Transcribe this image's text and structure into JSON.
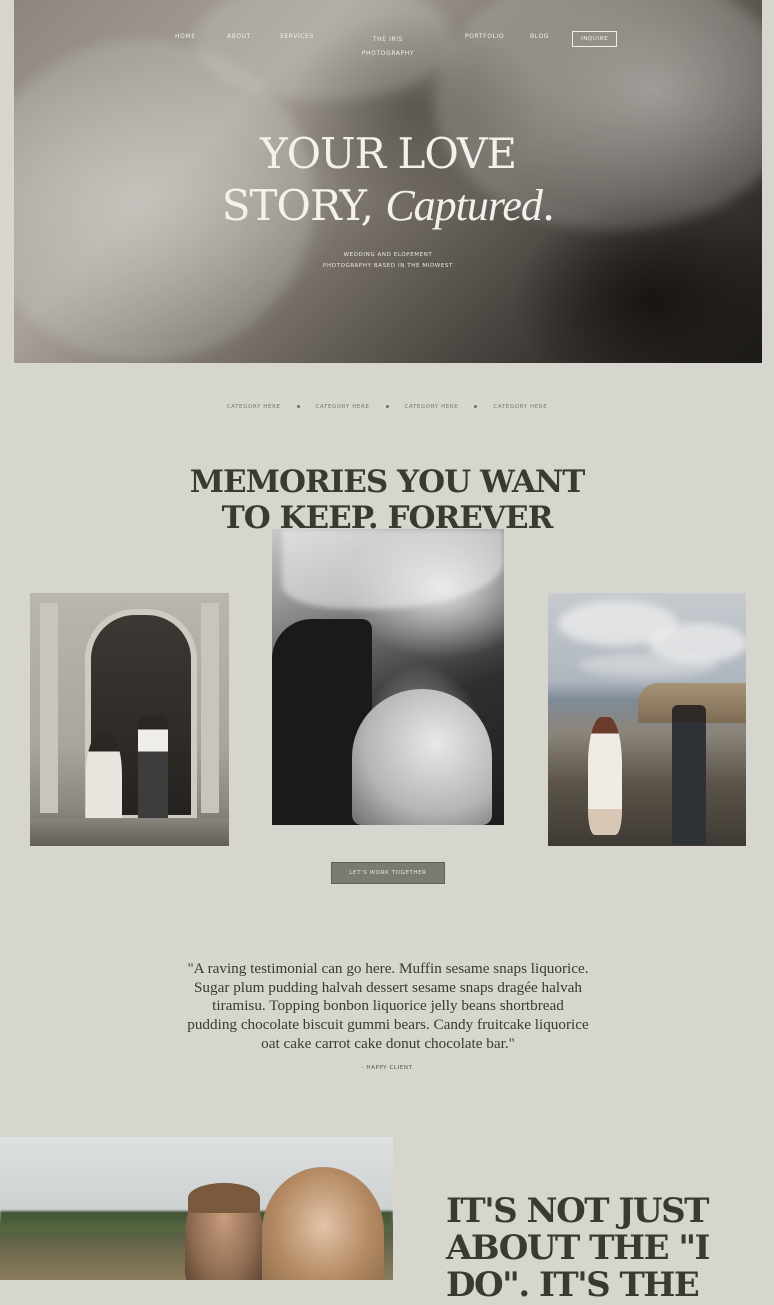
{
  "nav": {
    "items": [
      "HOME",
      "ABOUT",
      "SERVICES",
      "PORTFOLIO",
      "BLOG"
    ],
    "logo_line1": "THE IRIS",
    "logo_line2": "PHOTOGRAPHY",
    "inquire_label": "INQUIRE"
  },
  "hero": {
    "title_line1": "YOUR LOVE",
    "title_line2_a": "STORY, ",
    "title_line2_script": "Captured",
    "title_line2_end": ".",
    "subtitle_line1": "WEDDING AND ELOPEMENT",
    "subtitle_line2": "PHOTOGRAPHY BASED IN THE MIDWEST"
  },
  "categories": [
    "CATEGORY HERE",
    "CATEGORY HERE",
    "CATEGORY HERE",
    "CATEGORY HERE"
  ],
  "memories": {
    "title_line1": "MEMORIES YOU WANT",
    "title_line2": "TO KEEP. FOREVER"
  },
  "cta": {
    "label": "LET'S WORK TOGETHER"
  },
  "testimonial": {
    "lines": [
      "\"A raving testimonial can go here. Muffin sesame snaps liquorice.",
      "Sugar plum pudding halvah dessert sesame snaps dragée halvah",
      "tiramisu. Topping bonbon liquorice jelly beans shortbread",
      "pudding chocolate biscuit gummi bears. Candy fruitcake liquorice",
      "oat cake carrot cake donut chocolate bar.\""
    ],
    "author": "- HAPPY CLIENT"
  },
  "bottom": {
    "title_line1": "IT'S NOT JUST",
    "title_line2": "ABOUT THE \"I",
    "title_line3": "DO\". IT'S THE"
  }
}
